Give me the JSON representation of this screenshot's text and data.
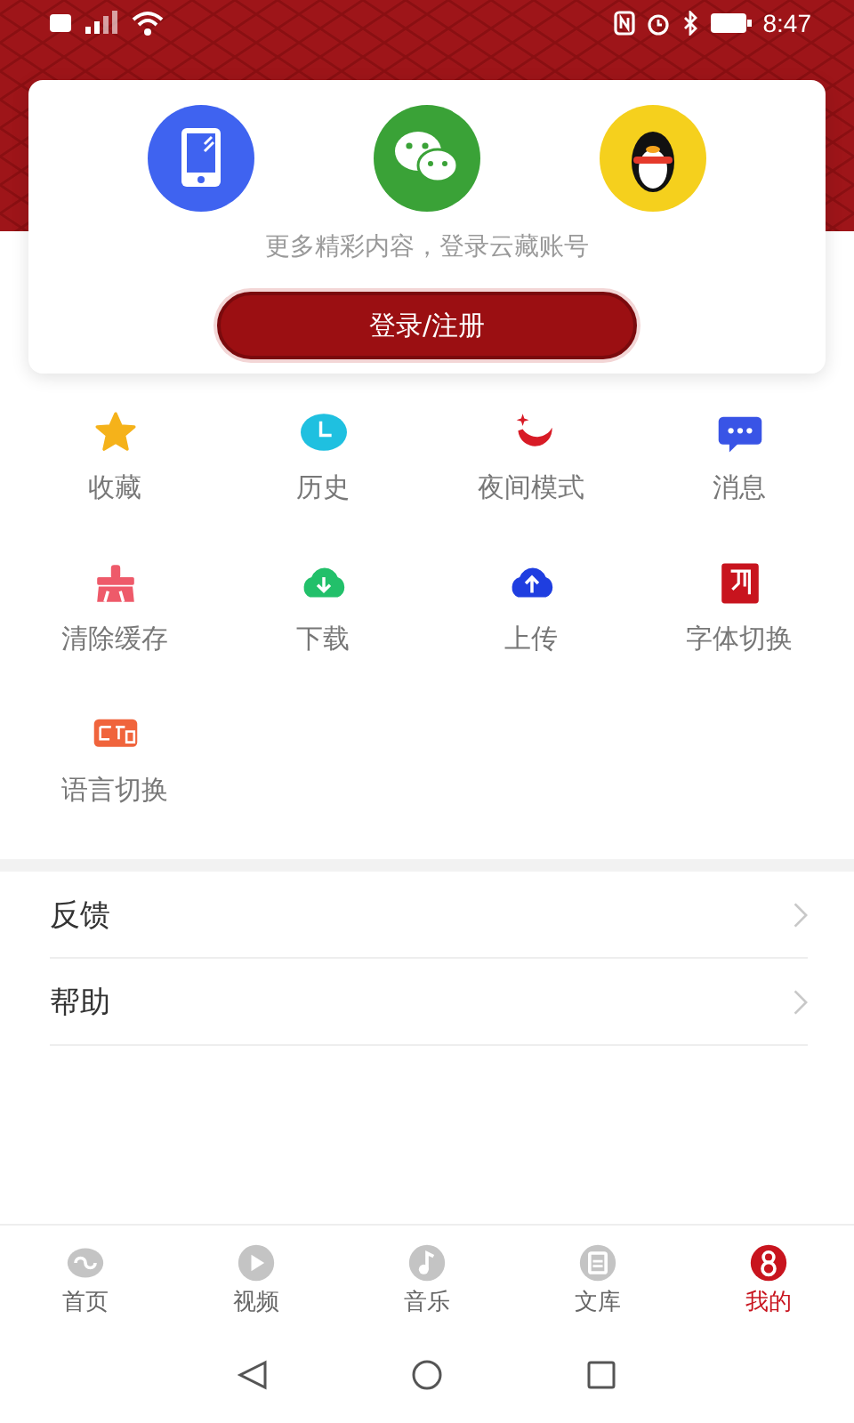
{
  "status_bar": {
    "time": "8:47"
  },
  "login_card": {
    "methods": [
      {
        "kind": "phone"
      },
      {
        "kind": "wechat"
      },
      {
        "kind": "qq"
      }
    ],
    "prompt": "更多精彩内容，登录云藏账号",
    "button": "登录/注册"
  },
  "features": [
    {
      "label": "收藏",
      "kind": "star"
    },
    {
      "label": "历史",
      "kind": "clock"
    },
    {
      "label": "夜间模式",
      "kind": "moon"
    },
    {
      "label": "消息",
      "kind": "message"
    },
    {
      "label": "清除缓存",
      "kind": "clear"
    },
    {
      "label": "下载",
      "kind": "download"
    },
    {
      "label": "上传",
      "kind": "upload"
    },
    {
      "label": "字体切换",
      "kind": "font"
    },
    {
      "label": "语言切换",
      "kind": "language"
    }
  ],
  "menu": [
    {
      "label": "反馈"
    },
    {
      "label": "帮助"
    }
  ],
  "tabs": [
    {
      "label": "首页",
      "kind": "home",
      "selected": false
    },
    {
      "label": "视频",
      "kind": "video",
      "selected": false
    },
    {
      "label": "音乐",
      "kind": "music",
      "selected": false
    },
    {
      "label": "文库",
      "kind": "library",
      "selected": false
    },
    {
      "label": "我的",
      "kind": "me",
      "selected": true
    }
  ]
}
